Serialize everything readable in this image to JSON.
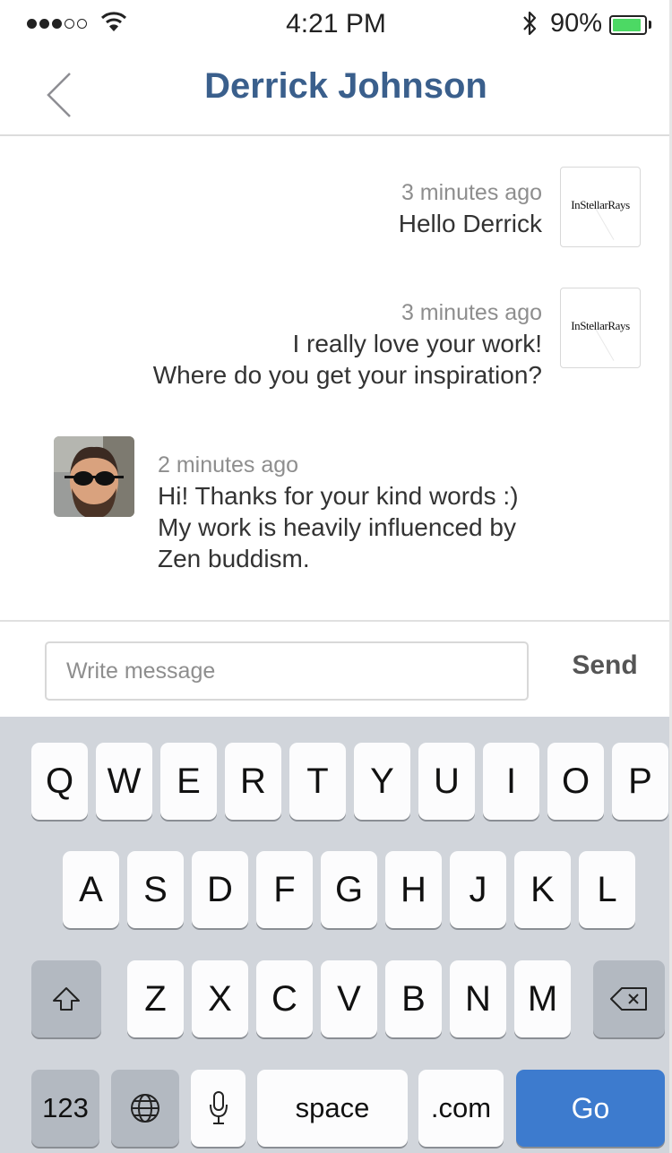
{
  "status_bar": {
    "time": "4:21 PM",
    "battery_percent": "90%",
    "battery_level": 0.9,
    "signal_bars_filled": 3,
    "signal_bars_total": 5,
    "icons": [
      "wifi-icon",
      "bluetooth-icon",
      "battery-icon"
    ]
  },
  "nav": {
    "title": "Derrick Johnson",
    "back_icon": "chevron-left-icon"
  },
  "messages": [
    {
      "direction": "outgoing",
      "time": "3 minutes ago",
      "lines": [
        "Hello Derrick"
      ],
      "avatar_text": "InStellarRays"
    },
    {
      "direction": "outgoing",
      "time": "3 minutes ago",
      "lines": [
        "I really love your work!",
        "Where do you get your inspiration?"
      ],
      "avatar_text": "InStellarRays"
    },
    {
      "direction": "incoming",
      "time": "2 minutes ago",
      "lines": [
        "Hi! Thanks for your kind words :)",
        "My work is heavily influenced by",
        "Zen buddism."
      ]
    }
  ],
  "composer": {
    "placeholder": "Write message",
    "send_label": "Send"
  },
  "keyboard": {
    "row1": [
      "Q",
      "W",
      "E",
      "R",
      "T",
      "Y",
      "U",
      "I",
      "O",
      "P"
    ],
    "row2": [
      "A",
      "S",
      "D",
      "F",
      "G",
      "H",
      "J",
      "K",
      "L"
    ],
    "row3": [
      "Z",
      "X",
      "C",
      "V",
      "B",
      "N",
      "M"
    ],
    "numbers_label": "123",
    "space_label": "space",
    "dotcom_label": ".com",
    "go_label": "Go",
    "special_icons": [
      "shift-icon",
      "backspace-icon",
      "globe-icon",
      "microphone-icon"
    ]
  },
  "colors": {
    "title": "#3a5f8c",
    "go_key": "#3d7bce",
    "battery": "#4cd964",
    "keyboard_bg": "#d1d5db"
  }
}
